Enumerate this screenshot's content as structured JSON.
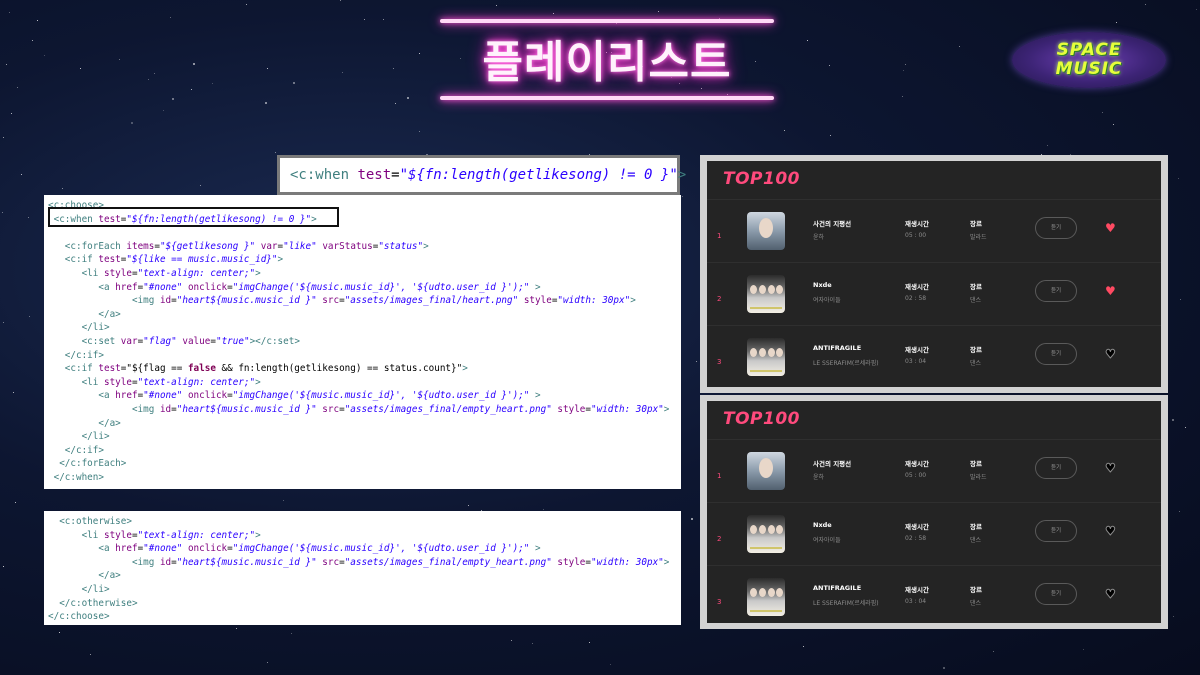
{
  "slide": {
    "title": "플레이리스트",
    "logo": {
      "line1": "SPACE",
      "line2": "MUSIC"
    },
    "colors": {
      "neon_pink": "#ff3bd0",
      "accent_red": "#ff4a7d",
      "heart_red": "#ff4a62",
      "logo_yellow": "#e6ff3a"
    }
  },
  "code_zoom": [
    {
      "t": "tag",
      "v": "<c:when "
    },
    {
      "t": "attr",
      "v": "test"
    },
    {
      "t": "plain",
      "v": "="
    },
    {
      "t": "str",
      "v": "\"${fn:length(getlikesong) != 0 }\""
    },
    {
      "t": "tag",
      "v": ">"
    }
  ],
  "code_main": [
    [
      {
        "t": "tag",
        "v": "<c:choose>"
      }
    ],
    [
      {
        "t": "tag",
        "v": " <c:when "
      },
      {
        "t": "attr",
        "v": "test"
      },
      {
        "t": "plain",
        "v": "="
      },
      {
        "t": "str",
        "v": "\"${fn:length(getlikesong) != 0 }\""
      },
      {
        "t": "tag",
        "v": ">"
      }
    ],
    [],
    [
      {
        "t": "tag",
        "v": "   <c:forEach "
      },
      {
        "t": "attr",
        "v": "items"
      },
      {
        "t": "plain",
        "v": "="
      },
      {
        "t": "str",
        "v": "\"${getlikesong }\""
      },
      {
        "t": "attr",
        "v": " var"
      },
      {
        "t": "plain",
        "v": "="
      },
      {
        "t": "str",
        "v": "\"like\""
      },
      {
        "t": "attr",
        "v": " varStatus"
      },
      {
        "t": "plain",
        "v": "="
      },
      {
        "t": "str",
        "v": "\"status\""
      },
      {
        "t": "tag",
        "v": ">"
      }
    ],
    [
      {
        "t": "tag",
        "v": "   <c:if "
      },
      {
        "t": "attr",
        "v": "test"
      },
      {
        "t": "plain",
        "v": "="
      },
      {
        "t": "str",
        "v": "\"${like == music.music_id}\""
      },
      {
        "t": "tag",
        "v": ">"
      }
    ],
    [
      {
        "t": "tag",
        "v": "      <li "
      },
      {
        "t": "attr",
        "v": "style"
      },
      {
        "t": "plain",
        "v": "="
      },
      {
        "t": "str",
        "v": "\"text-align: center;\""
      },
      {
        "t": "tag",
        "v": ">"
      }
    ],
    [
      {
        "t": "tag",
        "v": "         <a "
      },
      {
        "t": "attr",
        "v": "href"
      },
      {
        "t": "plain",
        "v": "="
      },
      {
        "t": "str",
        "v": "\"#none\""
      },
      {
        "t": "attr",
        "v": " onclick"
      },
      {
        "t": "plain",
        "v": "="
      },
      {
        "t": "str",
        "v": "\"imgChange('${music.music_id}', '${udto.user_id }');\""
      },
      {
        "t": "tag",
        "v": " >"
      }
    ],
    [
      {
        "t": "tag",
        "v": "               <img "
      },
      {
        "t": "attr",
        "v": "id"
      },
      {
        "t": "plain",
        "v": "="
      },
      {
        "t": "str",
        "v": "\"heart${music.music_id }\""
      },
      {
        "t": "attr",
        "v": " src"
      },
      {
        "t": "plain",
        "v": "="
      },
      {
        "t": "str",
        "v": "\"assets/images_final/heart.png\""
      },
      {
        "t": "attr",
        "v": " style"
      },
      {
        "t": "plain",
        "v": "="
      },
      {
        "t": "str",
        "v": "\"width: 30px\""
      },
      {
        "t": "tag",
        "v": ">"
      }
    ],
    [
      {
        "t": "tag",
        "v": "         </a>"
      }
    ],
    [
      {
        "t": "tag",
        "v": "      </li>"
      }
    ],
    [
      {
        "t": "tag",
        "v": "      <c:set "
      },
      {
        "t": "attr",
        "v": "var"
      },
      {
        "t": "plain",
        "v": "="
      },
      {
        "t": "str",
        "v": "\"flag\""
      },
      {
        "t": "attr",
        "v": " value"
      },
      {
        "t": "plain",
        "v": "="
      },
      {
        "t": "str",
        "v": "\"true\""
      },
      {
        "t": "tag",
        "v": "></c:set>"
      }
    ],
    [
      {
        "t": "tag",
        "v": "   </c:if>"
      }
    ],
    [
      {
        "t": "tag",
        "v": "   <c:if "
      },
      {
        "t": "attr",
        "v": "test"
      },
      {
        "t": "plain",
        "v": "=\"${flag == "
      },
      {
        "t": "kw",
        "v": "false"
      },
      {
        "t": "plain",
        "v": " && fn:length(getlikesong) == status.count}\""
      },
      {
        "t": "tag",
        "v": ">"
      }
    ],
    [
      {
        "t": "tag",
        "v": "      <li "
      },
      {
        "t": "attr",
        "v": "style"
      },
      {
        "t": "plain",
        "v": "="
      },
      {
        "t": "str",
        "v": "\"text-align: center;\""
      },
      {
        "t": "tag",
        "v": ">"
      }
    ],
    [
      {
        "t": "tag",
        "v": "         <a "
      },
      {
        "t": "attr",
        "v": "href"
      },
      {
        "t": "plain",
        "v": "="
      },
      {
        "t": "str",
        "v": "\"#none\""
      },
      {
        "t": "attr",
        "v": " onclick"
      },
      {
        "t": "plain",
        "v": "="
      },
      {
        "t": "str",
        "v": "\"imgChange('${music.music_id}', '${udto.user_id }');\""
      },
      {
        "t": "tag",
        "v": " >"
      }
    ],
    [
      {
        "t": "tag",
        "v": "               <img "
      },
      {
        "t": "attr",
        "v": "id"
      },
      {
        "t": "plain",
        "v": "="
      },
      {
        "t": "str",
        "v": "\"heart${music.music_id }\""
      },
      {
        "t": "attr",
        "v": " src"
      },
      {
        "t": "plain",
        "v": "="
      },
      {
        "t": "str",
        "v": "\"assets/images_final/empty_heart.png\""
      },
      {
        "t": "attr",
        "v": " style"
      },
      {
        "t": "plain",
        "v": "="
      },
      {
        "t": "str",
        "v": "\"width: 30px\""
      },
      {
        "t": "tag",
        "v": ">"
      }
    ],
    [
      {
        "t": "tag",
        "v": "         </a>"
      }
    ],
    [
      {
        "t": "tag",
        "v": "      </li>"
      }
    ],
    [
      {
        "t": "tag",
        "v": "   </c:if>"
      }
    ],
    [
      {
        "t": "tag",
        "v": "  </c:forEach>"
      }
    ],
    [
      {
        "t": "tag",
        "v": " </c:when>"
      }
    ]
  ],
  "code_other": [
    [
      {
        "t": "tag",
        "v": "  <c:otherwise>"
      }
    ],
    [
      {
        "t": "tag",
        "v": "      <li "
      },
      {
        "t": "attr",
        "v": "style"
      },
      {
        "t": "plain",
        "v": "="
      },
      {
        "t": "str",
        "v": "\"text-align: center;\""
      },
      {
        "t": "tag",
        "v": ">"
      }
    ],
    [
      {
        "t": "tag",
        "v": "         <a "
      },
      {
        "t": "attr",
        "v": "href"
      },
      {
        "t": "plain",
        "v": "="
      },
      {
        "t": "str",
        "v": "\"#none\""
      },
      {
        "t": "attr",
        "v": " onclick"
      },
      {
        "t": "plain",
        "v": "="
      },
      {
        "t": "str",
        "v": "\"imgChange('${music.music_id}', '${udto.user_id }');\""
      },
      {
        "t": "tag",
        "v": " >"
      }
    ],
    [
      {
        "t": "tag",
        "v": "               <img "
      },
      {
        "t": "attr",
        "v": "id"
      },
      {
        "t": "plain",
        "v": "="
      },
      {
        "t": "str",
        "v": "\"heart${music.music_id }\""
      },
      {
        "t": "attr",
        "v": " src"
      },
      {
        "t": "plain",
        "v": "="
      },
      {
        "t": "str",
        "v": "\"assets/images_final/empty_heart.png\""
      },
      {
        "t": "attr",
        "v": " style"
      },
      {
        "t": "plain",
        "v": "="
      },
      {
        "t": "str",
        "v": "\"width: 30px\""
      },
      {
        "t": "tag",
        "v": ">"
      }
    ],
    [
      {
        "t": "tag",
        "v": "         </a>"
      }
    ],
    [
      {
        "t": "tag",
        "v": "      </li>"
      }
    ],
    [
      {
        "t": "tag",
        "v": "  </c:otherwise>"
      }
    ],
    [
      {
        "t": "tag",
        "v": "</c:choose>"
      }
    ]
  ],
  "panel_top": {
    "heading": "TOP100",
    "rows": [
      {
        "rank": "1",
        "title": "사건의 지평선",
        "artist": "윤하",
        "time_label": "재생시간",
        "time": "05 : 00",
        "genre_label": "장르",
        "genre": "발라드",
        "button": "듣기",
        "liked": true,
        "cover": "solo"
      },
      {
        "rank": "2",
        "title": "Nxde",
        "artist": "여자아이들",
        "time_label": "재생시간",
        "time": "02 : 58",
        "genre_label": "장르",
        "genre": "댄스",
        "button": "듣기",
        "liked": true,
        "cover": "group"
      },
      {
        "rank": "3",
        "title": "ANTIFRAGILE",
        "artist": "LE SSERAFIM(르세라핌)",
        "time_label": "재생시간",
        "time": "03 : 04",
        "genre_label": "장르",
        "genre": "댄스",
        "button": "듣기",
        "liked": false,
        "cover": "group"
      }
    ]
  },
  "panel_bottom": {
    "heading": "TOP100",
    "rows": [
      {
        "rank": "1",
        "title": "사건의 지평선",
        "artist": "윤하",
        "time_label": "재생시간",
        "time": "05 : 00",
        "genre_label": "장르",
        "genre": "발라드",
        "button": "듣기",
        "liked": false,
        "cover": "solo"
      },
      {
        "rank": "2",
        "title": "Nxde",
        "artist": "여자아이들",
        "time_label": "재생시간",
        "time": "02 : 58",
        "genre_label": "장르",
        "genre": "댄스",
        "button": "듣기",
        "liked": false,
        "cover": "group"
      },
      {
        "rank": "3",
        "title": "ANTIFRAGILE",
        "artist": "LE SSERAFIM(르세라핌)",
        "time_label": "재생시간",
        "time": "03 : 04",
        "genre_label": "장르",
        "genre": "댄스",
        "button": "듣기",
        "liked": false,
        "cover": "group"
      }
    ]
  }
}
